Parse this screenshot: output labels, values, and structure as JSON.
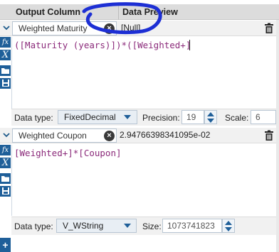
{
  "header": {
    "output_column": "Output Column",
    "data_preview": "Data Preview"
  },
  "colors": {
    "accent": "#1f5f99",
    "annotation": "#1d2fd4",
    "expression_text": "#8b2a7a"
  },
  "fields": [
    {
      "name": "Weighted Maturity",
      "preview": "[Null]",
      "expression": "([Maturity (years)])*([Weighted+]",
      "data_type": "FixedDecimal",
      "precision_label": "Precision:",
      "precision": "19",
      "scale_label": "Scale:",
      "scale": "6"
    },
    {
      "name": "Weighted Coupon",
      "preview": "2.94766398341095e-02",
      "expression": "[Weighted+]*[Coupon]",
      "data_type": "V_WString",
      "size_label": "Size:",
      "size": "1073741823"
    }
  ],
  "labels": {
    "data_type": "Data type:"
  },
  "icons": {
    "collapse": "chevron-down-icon",
    "clear": "close-icon",
    "trash": "trash-icon",
    "function": "function-icon",
    "variable": "variable-icon",
    "folder": "folder-icon",
    "save": "save-icon",
    "add": "add-icon"
  }
}
